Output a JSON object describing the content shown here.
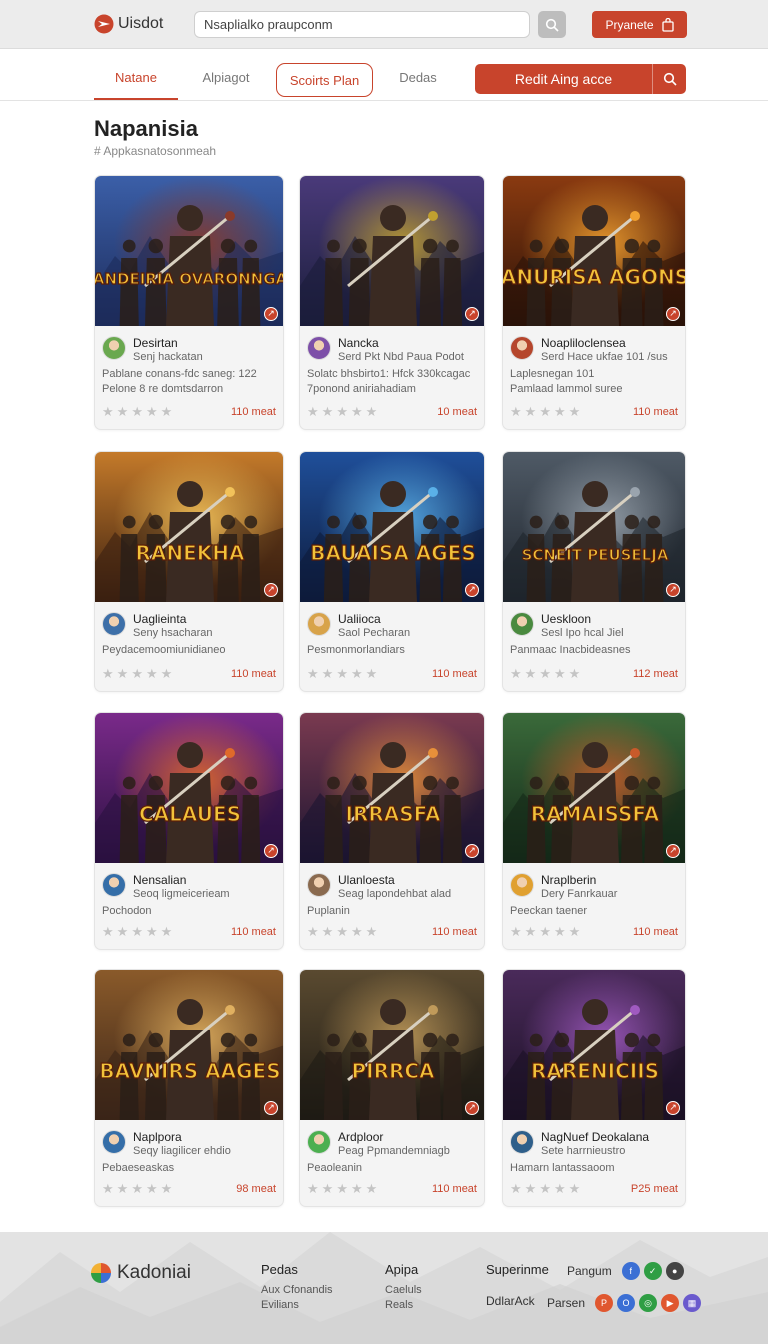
{
  "header": {
    "logo_text": "Uisdot",
    "search_value": "Nsaplialko praupconm",
    "account_label": "Pryanete"
  },
  "nav": {
    "tabs": [
      "Natane",
      "Alpiagot",
      "Scoirts Plan",
      "Dedas"
    ],
    "active_tab": "Natane",
    "cta_label": "Redit Aing acce"
  },
  "page": {
    "title": "Napanisia",
    "subtitle": "# Appkasnatosonmeah"
  },
  "cards": [
    {
      "name": "Desirtan",
      "studio": "Senj hackatan",
      "desc": [
        "Pablane conans-fdc saneg: 122",
        "Pelone 8 re domtsdarron"
      ],
      "price": "110 meat",
      "poster_text": "ANDEIRIA OVARONNGA",
      "scene": "fantasy",
      "avatar_color": "#6aa84f"
    },
    {
      "name": "Nancka",
      "studio": "Serd Pkt Nbd Paua Podot",
      "desc": [
        "Solatc bhsbirto1: Hfck 330kcagac",
        "7ponond aniriahadiam"
      ],
      "price": "10 meat",
      "poster_text": "",
      "scene": "hero",
      "avatar_color": "#7d4fa8"
    },
    {
      "name": "Noapliloclensea",
      "studio": "Serd Hace ukfae 101 /sus",
      "desc": [
        "Laplesnegan 101",
        "Pamlaad lammol suree"
      ],
      "price": "110 meat",
      "poster_text": "ANURISA AGONS",
      "scene": "fire",
      "avatar_color": "#b5462c"
    },
    {
      "name": "Uaglieinta",
      "studio": "Seny hsacharan",
      "desc": [
        "Peydacemoomiunidianeo"
      ],
      "price": "110 meat",
      "poster_text": "RANEKHA",
      "scene": "desert",
      "avatar_color": "#3d6fa8"
    },
    {
      "name": "Ualiioca",
      "studio": "Saol Pecharan",
      "desc": [
        "Pesmonmorlandiars"
      ],
      "price": "110 meat",
      "poster_text": "BAUAISA AGES",
      "scene": "blue",
      "avatar_color": "#d8a34a"
    },
    {
      "name": "Ueskloon",
      "studio": "Sesl Ipo hcal Jiel",
      "desc": [
        "Panmaac Inacbideasnes"
      ],
      "price": "112 meat",
      "poster_text": "SCNEIT PEUSELJA",
      "scene": "grey",
      "avatar_color": "#4a8a3f"
    },
    {
      "name": "Nensalian",
      "studio": "Seoq ligmeicerieam",
      "desc": [
        "Pochodon"
      ],
      "price": "110 meat",
      "poster_text": "CALAUES",
      "scene": "purple",
      "avatar_color": "#356ea8"
    },
    {
      "name": "Ulanloesta",
      "studio": "Seag lapondehbat alad",
      "desc": [
        "Puplanin"
      ],
      "price": "110 meat",
      "poster_text": "IRRASFA",
      "scene": "sunset",
      "avatar_color": "#8a6a4f"
    },
    {
      "name": "Nraplberin",
      "studio": "Dery Fanrkauar",
      "desc": [
        "Peeckan taener"
      ],
      "price": "110 meat",
      "poster_text": "RAMAISSFA",
      "scene": "green",
      "avatar_color": "#e0a030"
    },
    {
      "name": "Naplpora",
      "studio": "Seqy liagilicer ehdio",
      "desc": [
        "Pebaeseaskas"
      ],
      "price": "98 meat",
      "poster_text": "BAVNIRS AAGES",
      "scene": "town",
      "avatar_color": "#356ea8"
    },
    {
      "name": "Ardploor",
      "studio": "Peag Ppmandemniagb",
      "desc": [
        "Peaoleanin"
      ],
      "price": "110 meat",
      "poster_text": "PIRRCA",
      "scene": "brown",
      "avatar_color": "#4caf50"
    },
    {
      "name": "NagNuef Deokalana",
      "studio": "Sete harrnieustro",
      "desc": [
        "Hamarn lantassaoom"
      ],
      "price": "P25 meat",
      "poster_text": "RARENICIIS",
      "scene": "violet",
      "avatar_color": "#2f5f8a"
    }
  ],
  "footer": {
    "logo_text": "Kadoniai",
    "columns": [
      {
        "title": "Pedas",
        "links": [
          "Aux Cfonandis",
          "Evilians"
        ]
      },
      {
        "title": "Apipa",
        "links": [
          "Caeluls",
          "Reals"
        ]
      }
    ],
    "social_title": "Superinme",
    "social_rows": [
      {
        "label": "Pangum",
        "icons": [
          "facebook-icon",
          "check-icon",
          "chat-icon"
        ]
      },
      {
        "label": "DdlarAck",
        "icons": []
      },
      {
        "label": "Parsen",
        "icons": [
          "p-icon",
          "o-icon",
          "ring-icon",
          "play-icon",
          "grid-icon"
        ]
      }
    ],
    "social_colors": {
      "facebook-icon": "#3b6fd4",
      "check-icon": "#2f9e44",
      "chat-icon": "#444444",
      "p-icon": "#e0572f",
      "o-icon": "#3b6fd4",
      "ring-icon": "#2f9e44",
      "play-icon": "#e0572f",
      "grid-icon": "#6a5acd"
    }
  },
  "colors": {
    "accent": "#c8442c"
  }
}
